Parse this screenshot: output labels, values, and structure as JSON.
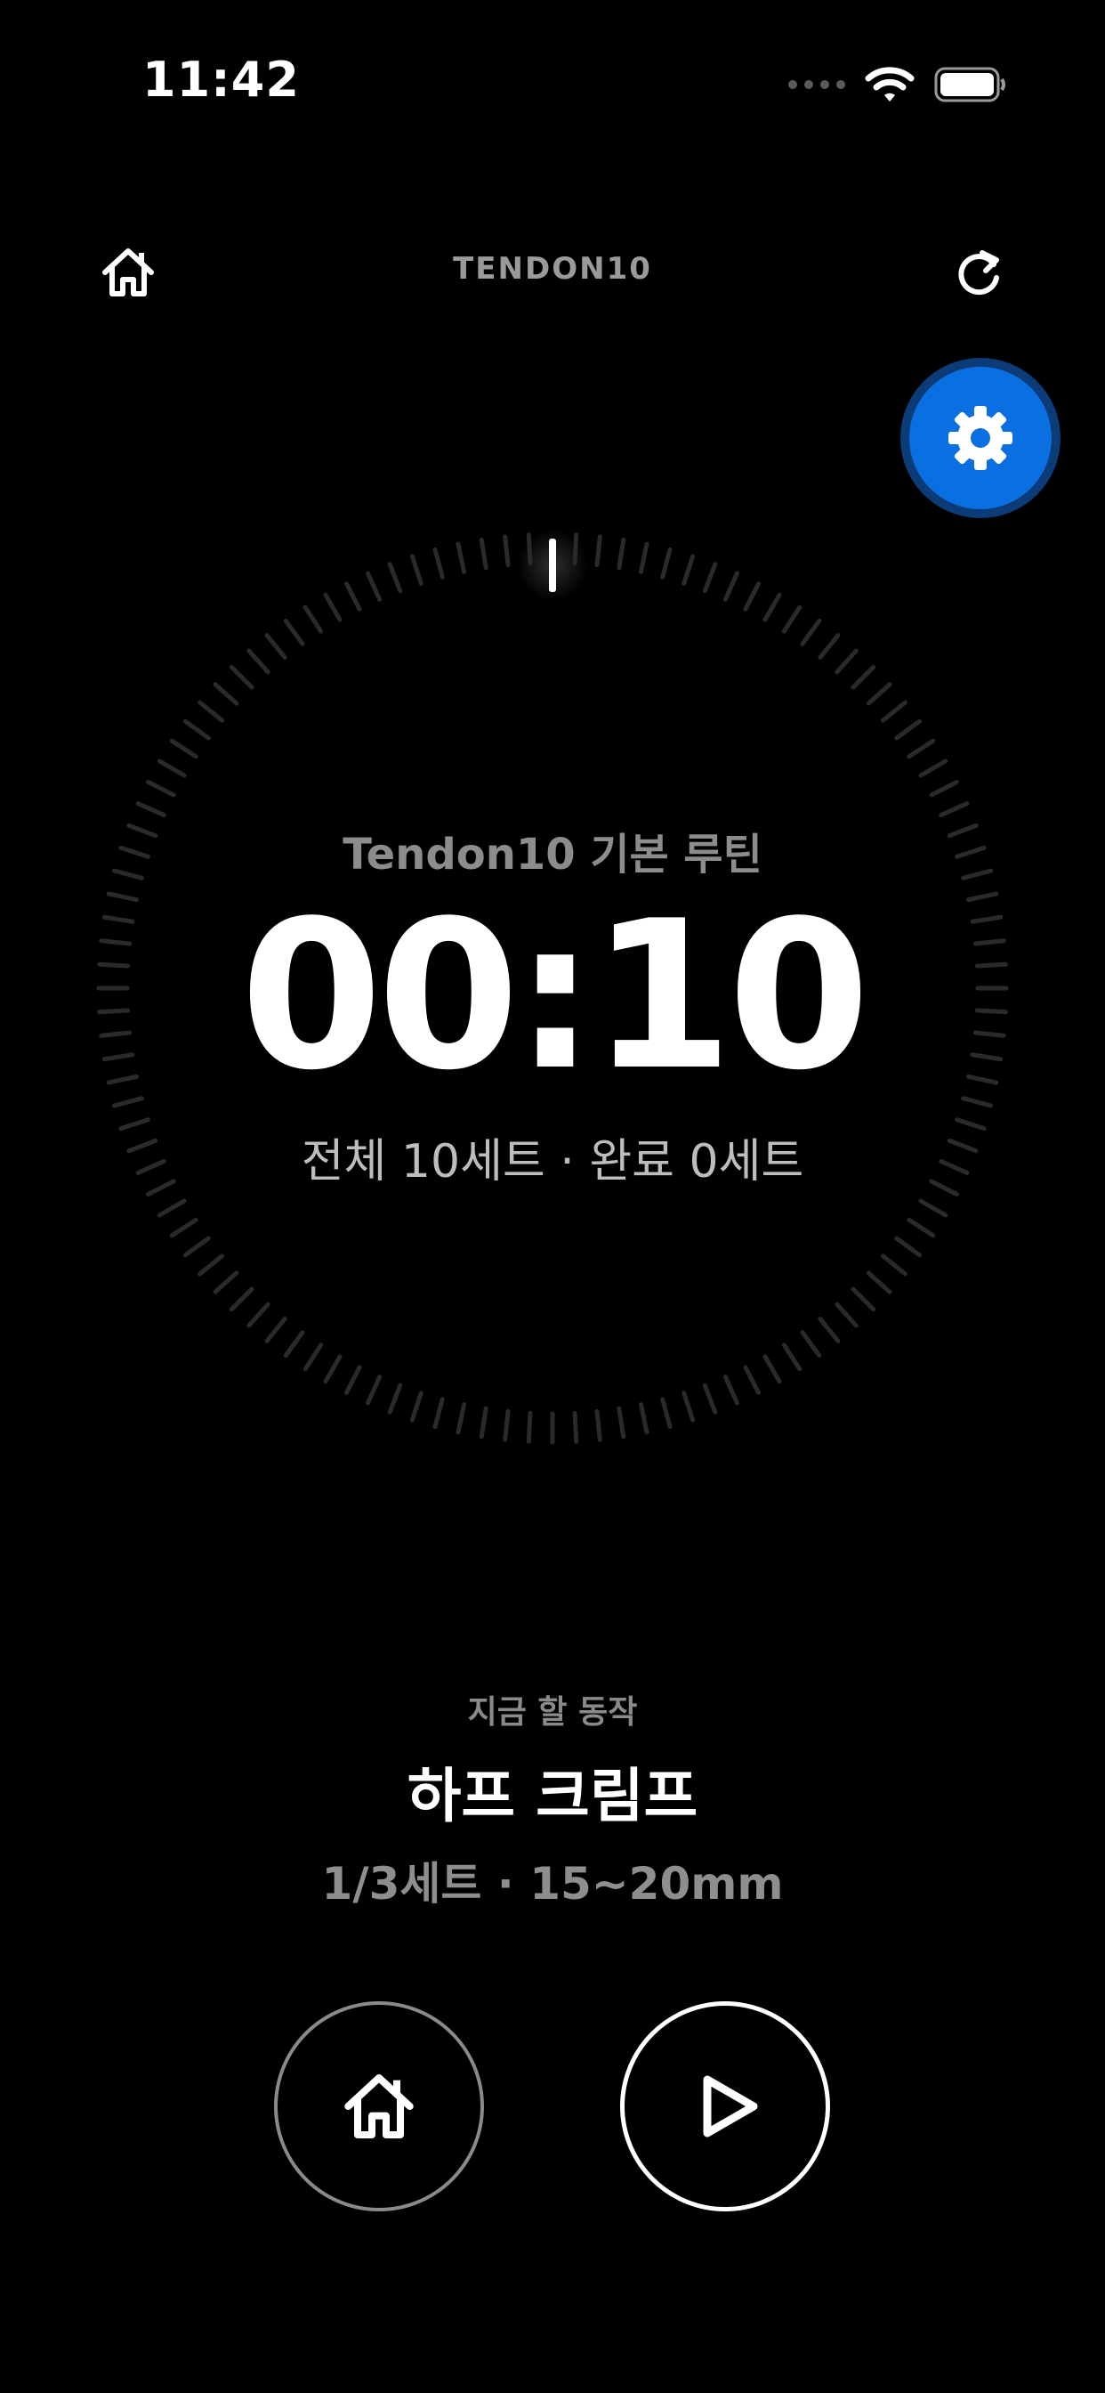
{
  "status_bar": {
    "time": "11:42",
    "icons": [
      "signal-dots-icon",
      "wifi-icon",
      "battery-icon"
    ]
  },
  "header": {
    "title": "TENDON10",
    "left_icon": "home-icon",
    "right_icon": "refresh-icon"
  },
  "settings_button": {
    "icon": "gear-icon",
    "color": "#0a6fe0"
  },
  "timer": {
    "routine_name": "Tendon10 기본 루틴",
    "display": "00:10",
    "summary": "전체 10세트 · 완료 0세트"
  },
  "current_exercise": {
    "label": "지금 할 동작",
    "name": "하프 크림프",
    "detail": "1/3세트 · 15~20mm"
  },
  "controls": {
    "home_icon": "home-icon",
    "play_icon": "play-icon"
  },
  "colors": {
    "background": "#000000",
    "accent": "#0a6fe0",
    "muted_text": "#8c8c8c"
  }
}
